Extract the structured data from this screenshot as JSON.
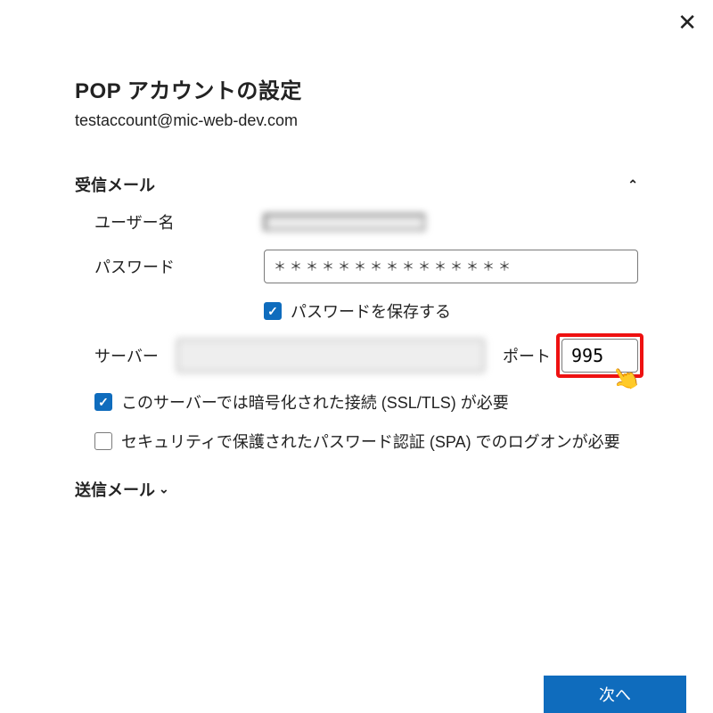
{
  "title": "POP アカウントの設定",
  "email": "testaccount@mic-web-dev.com",
  "incoming": {
    "section_title": "受信メール",
    "username_label": "ユーザー名",
    "username_value": "",
    "password_label": "パスワード",
    "password_mask": "＊＊＊＊＊＊＊＊＊＊＊＊＊＊＊",
    "save_password_label": "パスワードを保存する",
    "save_password_checked": true,
    "server_label": "サーバー",
    "server_value": "",
    "port_label": "ポート",
    "port_value": "995",
    "ssl_label": "このサーバーでは暗号化された接続 (SSL/TLS) が必要",
    "ssl_checked": true,
    "spa_label": "セキュリティで保護されたパスワード認証 (SPA) でのログオンが必要",
    "spa_checked": false
  },
  "outgoing": {
    "section_title": "送信メール"
  },
  "next_label": "次へ"
}
